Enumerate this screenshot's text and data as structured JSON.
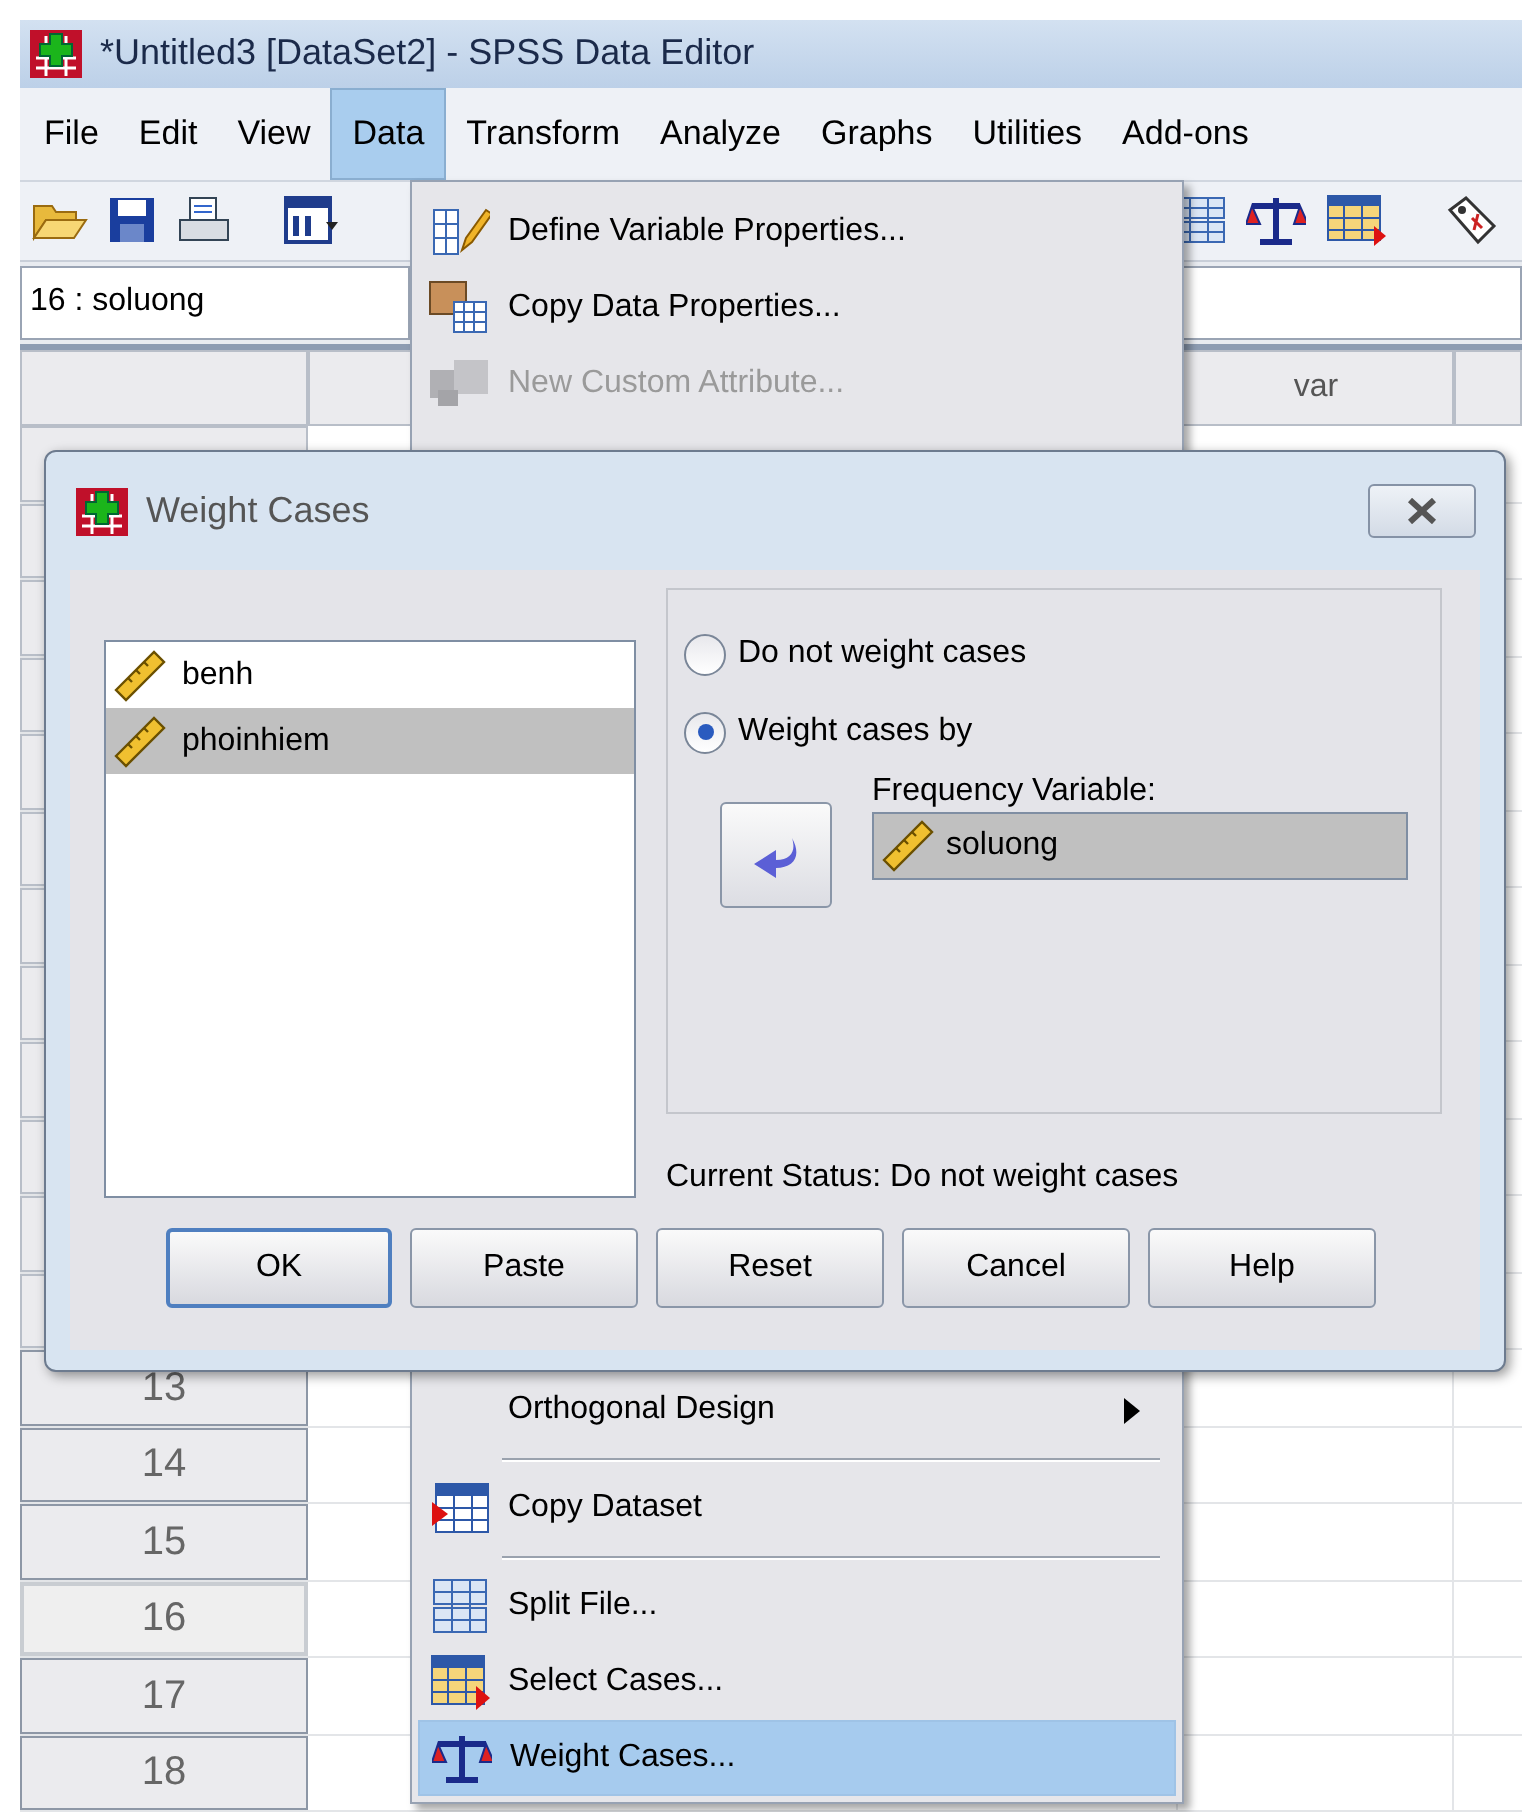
{
  "window": {
    "title": "*Untitled3 [DataSet2] - SPSS Data Editor"
  },
  "menu_bar": [
    {
      "label": "File",
      "selected": false
    },
    {
      "label": "Edit",
      "selected": false
    },
    {
      "label": "View",
      "selected": false
    },
    {
      "label": "Data",
      "selected": true
    },
    {
      "label": "Transform",
      "selected": false
    },
    {
      "label": "Analyze",
      "selected": false
    },
    {
      "label": "Graphs",
      "selected": false
    },
    {
      "label": "Utilities",
      "selected": false
    },
    {
      "label": "Add-ons",
      "selected": false
    }
  ],
  "cell_reference": "16 : soluong",
  "grid": {
    "column_header": "var",
    "rows": [
      {
        "label": "13",
        "selected": false
      },
      {
        "label": "14",
        "selected": false
      },
      {
        "label": "15",
        "selected": false
      },
      {
        "label": "16",
        "selected": true
      },
      {
        "label": "17",
        "selected": false
      },
      {
        "label": "18",
        "selected": false
      }
    ]
  },
  "data_menu": {
    "top_items": [
      {
        "label": "Define Variable Properties...",
        "disabled": false,
        "selected": false
      },
      {
        "label": "Copy Data Properties...",
        "disabled": false,
        "selected": false
      },
      {
        "label": "New Custom Attribute...",
        "disabled": true,
        "selected": false
      }
    ],
    "bottom_items": [
      {
        "kind": "item",
        "label": "Orthogonal Design",
        "submenu": true,
        "disabled": false,
        "selected": false
      },
      {
        "kind": "separator"
      },
      {
        "kind": "item",
        "label": "Copy Dataset",
        "submenu": false,
        "disabled": false,
        "selected": false
      },
      {
        "kind": "separator"
      },
      {
        "kind": "item",
        "label": "Split File...",
        "submenu": false,
        "disabled": false,
        "selected": false
      },
      {
        "kind": "item",
        "label": "Select Cases...",
        "submenu": false,
        "disabled": false,
        "selected": false
      },
      {
        "kind": "item",
        "label": "Weight Cases...",
        "submenu": false,
        "disabled": false,
        "selected": true
      }
    ]
  },
  "dialog": {
    "title": "Weight Cases",
    "variables": [
      {
        "name": "benh",
        "selected": false
      },
      {
        "name": "phoinhiem",
        "selected": true
      }
    ],
    "options": [
      {
        "label": "Do not weight cases",
        "selected": false
      },
      {
        "label": "Weight cases by",
        "selected": true
      }
    ],
    "frequency_label": "Frequency Variable:",
    "frequency_value": "soluong",
    "status": "Current Status: Do not weight cases",
    "buttons": [
      {
        "label": "OK",
        "default": true
      },
      {
        "label": "Paste",
        "default": false
      },
      {
        "label": "Reset",
        "default": false
      },
      {
        "label": "Cancel",
        "default": false
      },
      {
        "label": "Help",
        "default": false
      }
    ]
  }
}
